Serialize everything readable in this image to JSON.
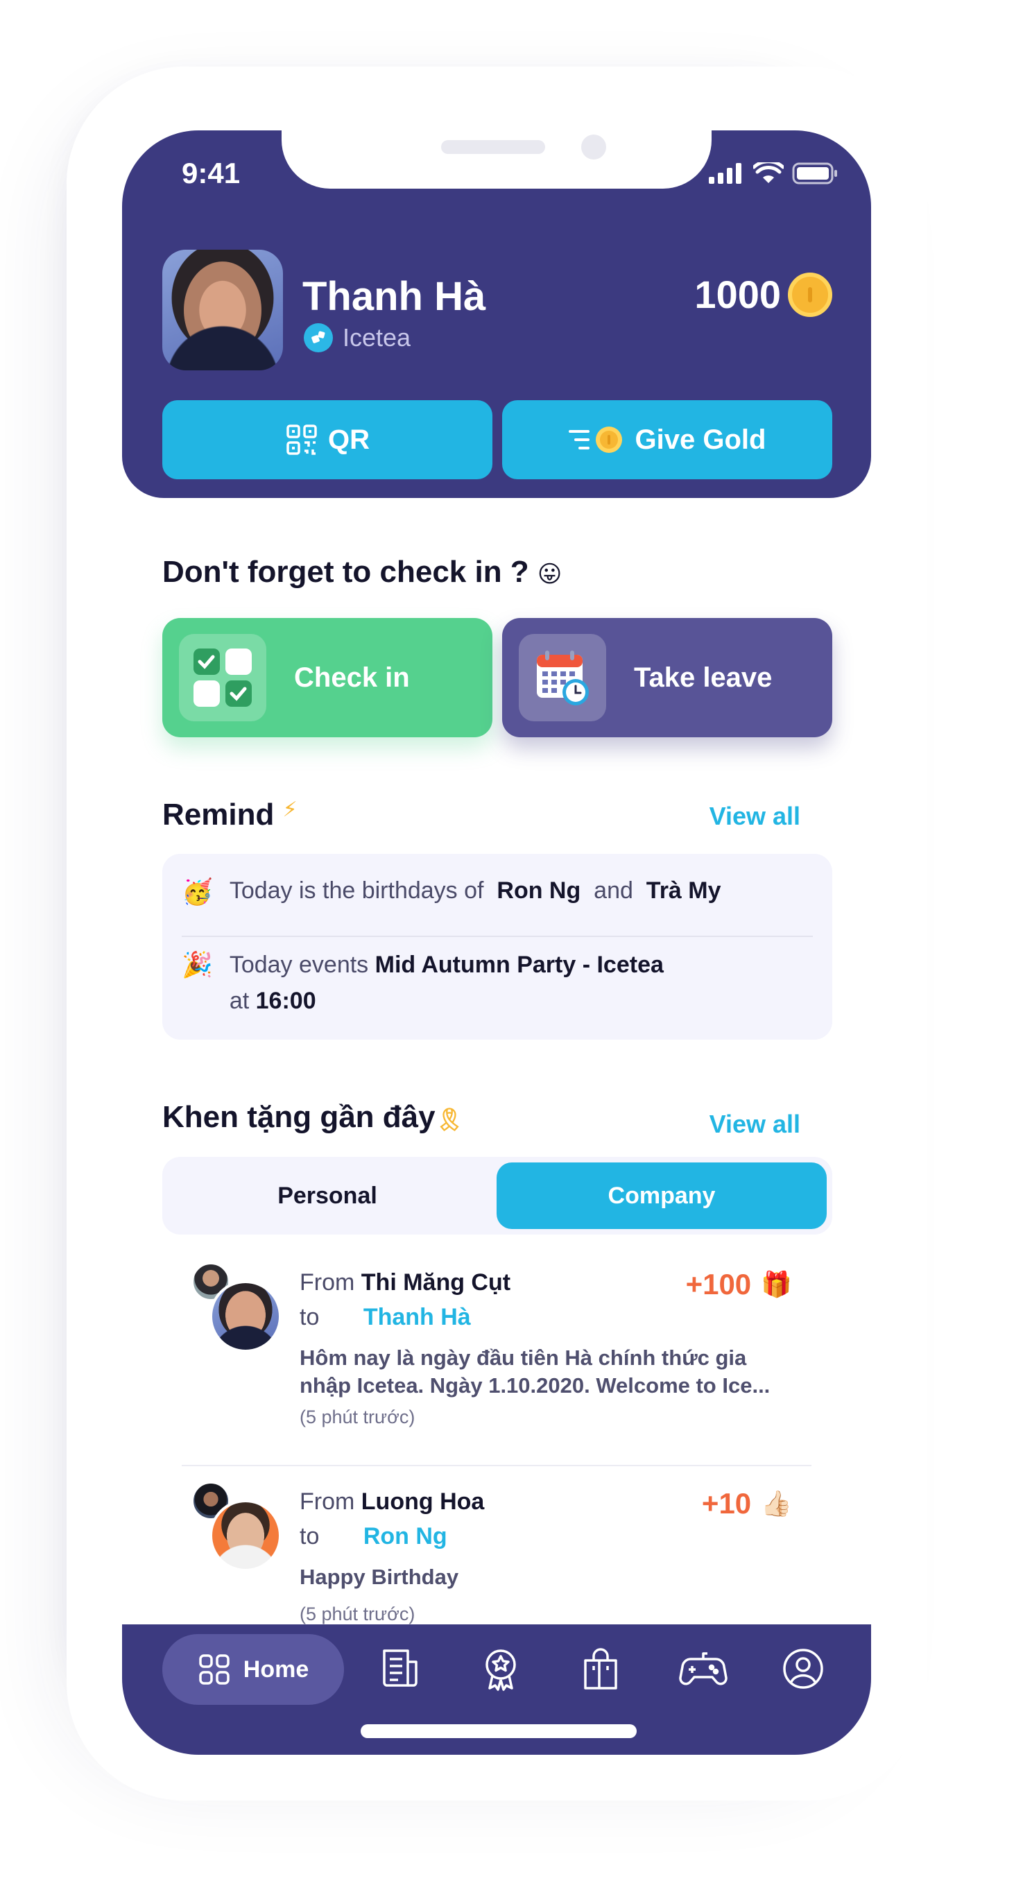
{
  "status_bar": {
    "time": "9:41"
  },
  "profile": {
    "name": "Thanh Hà",
    "company": "Icetea",
    "coins": "1000"
  },
  "header_buttons": {
    "qr": "QR",
    "give_gold": "Give Gold"
  },
  "checkin_section": {
    "title": "Don't forget to check in ?",
    "emoji": "😛",
    "check_in": "Check in",
    "take_leave": "Take leave"
  },
  "remind": {
    "title": "Remind",
    "title_emoji": "⚡",
    "view_all": "View all",
    "birthday": {
      "emoji": "🥳",
      "prefix": "Today is the birthdays of",
      "name1": "Ron Ng",
      "joiner": "and",
      "name2": "Trà My"
    },
    "event": {
      "emoji": "🎉",
      "prefix": "Today events",
      "name": "Mid Autumn Party - Icetea",
      "at_label": "at",
      "time": "16:00"
    }
  },
  "praise": {
    "title": "Khen tặng gần đây",
    "title_emoji": "🎗",
    "view_all": "View all",
    "tabs": {
      "personal": "Personal",
      "company": "Company",
      "active": "company"
    },
    "items": [
      {
        "from_label": "From",
        "from": "Thi Măng Cụt",
        "to_label": "to",
        "to": "Thanh Hà",
        "points": "+100",
        "points_emoji": "🎁",
        "message": "Hôm nay là ngày đầu tiên Hà chính thức gia nhập Icetea. Ngày 1.10.2020. Welcome to Ice...",
        "time": "(5 phút trước)"
      },
      {
        "from_label": "From",
        "from": "Luong Hoa",
        "to_label": "to",
        "to": "Ron Ng",
        "points": "+10",
        "points_emoji": "👍🏻",
        "message": "Happy Birthday",
        "time": "(5 phút trước)"
      }
    ]
  },
  "tabbar": {
    "home": "Home",
    "icons": [
      "home-icon",
      "news-icon",
      "award-icon",
      "shop-icon",
      "game-icon",
      "profile-icon"
    ]
  },
  "colors": {
    "primary": "#3c3a80",
    "accent": "#22b5e3",
    "success": "#55d18e",
    "secondary": "#585497",
    "points": "#f0673c"
  }
}
